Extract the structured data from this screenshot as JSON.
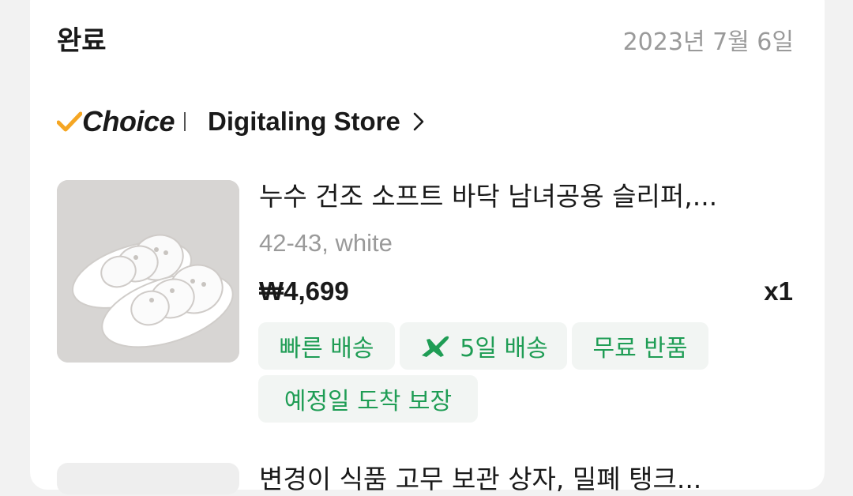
{
  "order": {
    "status": "완료",
    "date": "2023년 7월 6일"
  },
  "store": {
    "badge_text": "Choice",
    "badge_check_color": "#f5a623",
    "name": "Digitaling Store",
    "chevron_icon": "chevron-right-icon"
  },
  "item": {
    "title": "누수 건조 소프트 바닥 남녀공용 슬리퍼,...",
    "variant": "42-43, white",
    "price": "₩4,699",
    "quantity": "x1",
    "image_icon": "white-slippers-image",
    "tags": [
      {
        "label": "빠른 배송"
      },
      {
        "label": "5일 배송",
        "icon": "airplane-icon"
      },
      {
        "label": "무료 반품"
      },
      {
        "label": "예정일 도착 보장"
      }
    ]
  },
  "next_item": {
    "title": "변경이 식품 고무 보관 상자, 밀폐 탱크..."
  },
  "colors": {
    "tag_text": "#1f9d55",
    "tag_bg": "#f2f5f3",
    "muted_text": "#9a9a9a"
  }
}
